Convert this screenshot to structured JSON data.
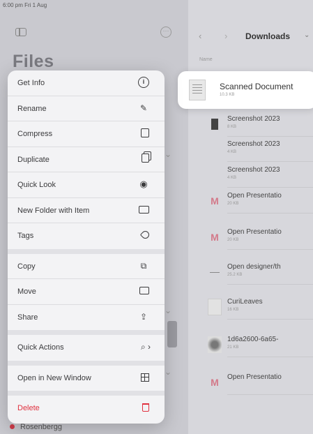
{
  "status_bar": {
    "time": "6:00 pm  Fri 1 Aug"
  },
  "sidebar": {
    "title": "Files"
  },
  "browser": {
    "title": "Downloads",
    "column_header": "Name",
    "highlighted": {
      "name": "Scanned Document",
      "meta": "10.3 KB"
    },
    "files": [
      {
        "name": "Screenshot 2023",
        "meta": "8 KB",
        "thumb": "dark"
      },
      {
        "name": "Screenshot 2023",
        "meta": "4 KB",
        "thumb": "blank"
      },
      {
        "name": "Screenshot 2023",
        "meta": "4 KB",
        "thumb": "blank"
      },
      {
        "name": "Open Presentatio",
        "meta": "20 KB",
        "thumb": "pres"
      },
      {
        "name": "Open Presentatio",
        "meta": "20 KB",
        "thumb": "pres"
      },
      {
        "name": "Open designer/th",
        "meta": "25.2 KB",
        "thumb": "line"
      },
      {
        "name": "CuriLeaves",
        "meta": "16 KB",
        "thumb": "leaf"
      },
      {
        "name": "1d6a2600-6a65-",
        "meta": "21 KB",
        "thumb": "img"
      },
      {
        "name": "Open Presentatio",
        "meta": "",
        "thumb": "pres"
      }
    ]
  },
  "context_menu": {
    "items": [
      {
        "label": "Get Info",
        "icon": "info-icon"
      },
      {
        "label": "Rename",
        "icon": "pencil-icon"
      },
      {
        "label": "Compress",
        "icon": "archive-icon"
      },
      {
        "label": "Duplicate",
        "icon": "duplicate-icon"
      },
      {
        "label": "Quick Look",
        "icon": "eye-icon"
      },
      {
        "label": "New Folder with Item",
        "icon": "folder-plus-icon"
      },
      {
        "label": "Tags",
        "icon": "tag-icon"
      },
      {
        "label": "Copy",
        "icon": "copy-icon"
      },
      {
        "label": "Move",
        "icon": "folder-move-icon"
      },
      {
        "label": "Share",
        "icon": "share-icon"
      },
      {
        "label": "Quick Actions",
        "icon": "quick-actions-icon"
      },
      {
        "label": "Open in New Window",
        "icon": "new-window-icon"
      },
      {
        "label": "Delete",
        "icon": "trash-icon"
      }
    ]
  },
  "bottom_item": {
    "label": "Rosenbergg"
  },
  "colors": {
    "danger": "#e0303e",
    "menu_bg": "#f3f3f5",
    "text": "#3a3a3c"
  }
}
